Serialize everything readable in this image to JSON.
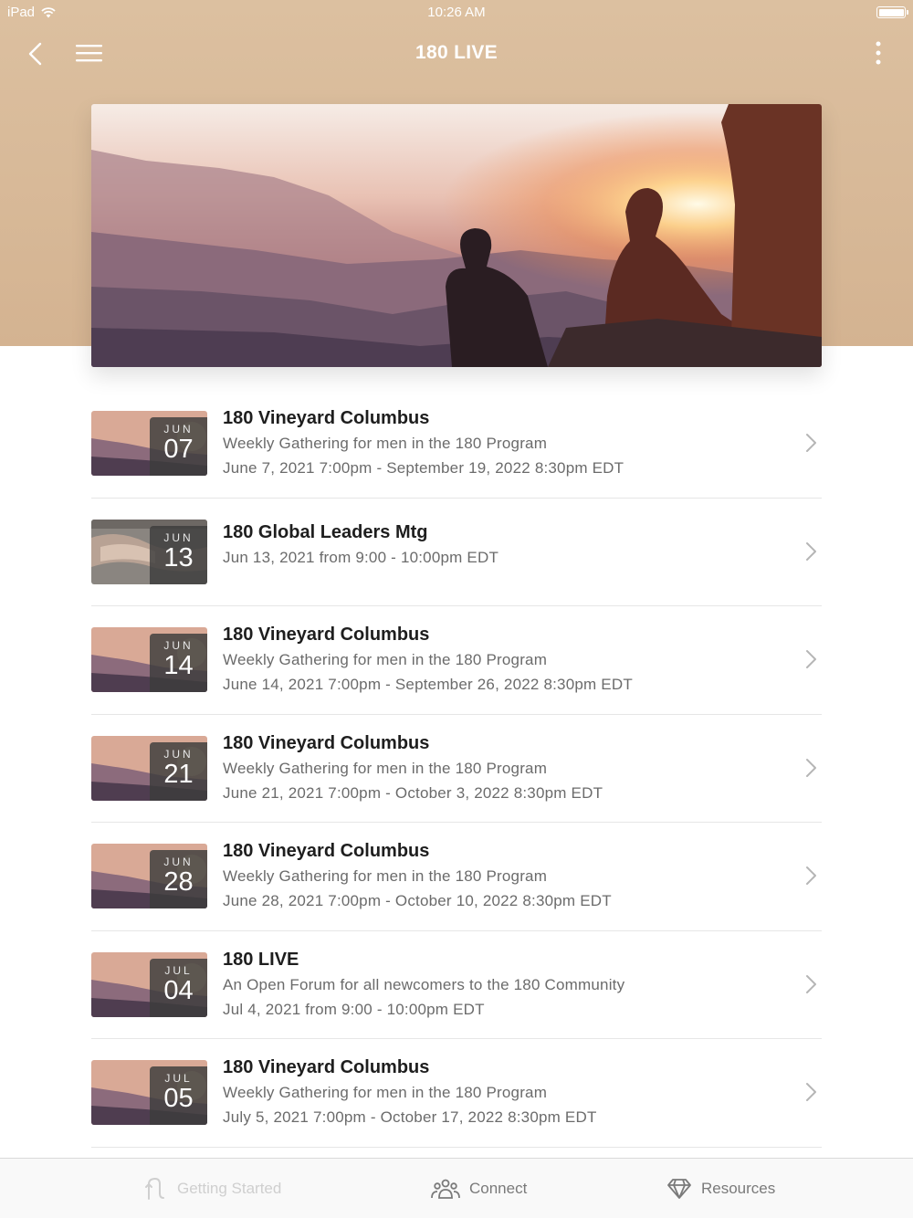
{
  "status_bar": {
    "device": "iPad",
    "time": "10:26 AM"
  },
  "nav": {
    "title": "180 LIVE",
    "icons": [
      "chevron-left-icon",
      "hamburger-menu-icon",
      "more-vertical-icon"
    ]
  },
  "events": [
    {
      "month": "JUN",
      "day": "07",
      "title": "180 Vineyard Columbus",
      "subtitle": "Weekly Gathering for men in the 180 Program",
      "dates": "June 7, 2021 7:00pm - September 19, 2022 8:30pm EDT",
      "thumb": "sunset"
    },
    {
      "month": "JUN",
      "day": "13",
      "title": "180 Global Leaders Mtg",
      "subtitle": "",
      "dates": "Jun 13, 2021 from 9:00 - 10:00pm EDT",
      "thumb": "hands"
    },
    {
      "month": "JUN",
      "day": "14",
      "title": "180 Vineyard Columbus",
      "subtitle": "Weekly Gathering for men in the 180 Program",
      "dates": "June 14, 2021 7:00pm - September 26, 2022 8:30pm EDT",
      "thumb": "sunset"
    },
    {
      "month": "JUN",
      "day": "21",
      "title": "180 Vineyard Columbus",
      "subtitle": "Weekly Gathering for men in the 180 Program",
      "dates": "June 21, 2021 7:00pm - October 3, 2022 8:30pm EDT",
      "thumb": "sunset"
    },
    {
      "month": "JUN",
      "day": "28",
      "title": "180 Vineyard Columbus",
      "subtitle": "Weekly Gathering for men in the 180 Program",
      "dates": "June 28, 2021 7:00pm - October 10, 2022 8:30pm EDT",
      "thumb": "sunset"
    },
    {
      "month": "JUL",
      "day": "04",
      "title": "180 LIVE",
      "subtitle": "An Open Forum for all newcomers to the 180 Community",
      "dates": "Jul 4, 2021 from 9:00 - 10:00pm EDT",
      "thumb": "sunset"
    },
    {
      "month": "JUL",
      "day": "05",
      "title": "180 Vineyard Columbus",
      "subtitle": "Weekly Gathering for men in the 180 Program",
      "dates": "July 5, 2021 7:00pm - October 17, 2022 8:30pm EDT",
      "thumb": "sunset"
    }
  ],
  "tab_bar": {
    "tabs": [
      {
        "label": "Getting Started",
        "icon": "path-icon",
        "enabled": false
      },
      {
        "label": "Connect",
        "icon": "people-icon",
        "enabled": true
      },
      {
        "label": "Resources",
        "icon": "diamond-icon",
        "enabled": true
      }
    ]
  },
  "colors": {
    "header_bg": "#d6b694",
    "text_primary": "#1e1e1e",
    "text_secondary": "#6b6b6b",
    "tab_inactive": "#7a7a7a",
    "tab_disabled": "#cfcfcf"
  }
}
